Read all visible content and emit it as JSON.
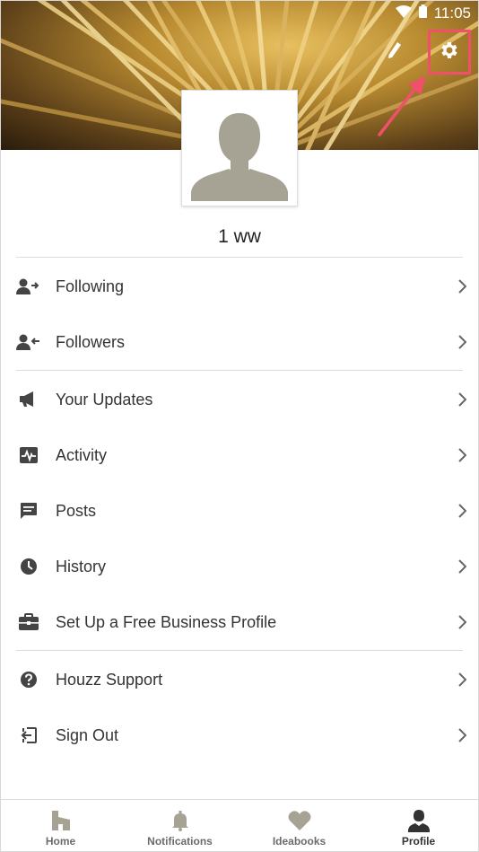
{
  "status_bar": {
    "time": "11:05",
    "icons": [
      "wifi-icon",
      "battery-icon"
    ]
  },
  "header": {
    "edit_icon": "pencil-icon",
    "settings_icon": "gear-icon",
    "highlight_color": "#f0506a"
  },
  "profile": {
    "username": "1 ww",
    "avatar_icon": "default-avatar-icon"
  },
  "menu": [
    {
      "label": "Following",
      "icon": "following-icon"
    },
    {
      "label": "Followers",
      "icon": "followers-icon"
    },
    {
      "label": "Your Updates",
      "icon": "megaphone-icon"
    },
    {
      "label": "Activity",
      "icon": "activity-icon"
    },
    {
      "label": "Posts",
      "icon": "chat-icon"
    },
    {
      "label": "History",
      "icon": "clock-icon"
    },
    {
      "label": "Set Up a Free Business Profile",
      "icon": "briefcase-icon"
    },
    {
      "label": "Houzz Support",
      "icon": "help-icon"
    },
    {
      "label": "Sign Out",
      "icon": "sign-out-icon"
    }
  ],
  "bottom_nav": [
    {
      "label": "Home",
      "icon": "houzz-icon"
    },
    {
      "label": "Notifications",
      "icon": "bell-icon"
    },
    {
      "label": "Ideabooks",
      "icon": "heart-icon"
    },
    {
      "label": "Profile",
      "icon": "person-icon",
      "active": true
    }
  ]
}
